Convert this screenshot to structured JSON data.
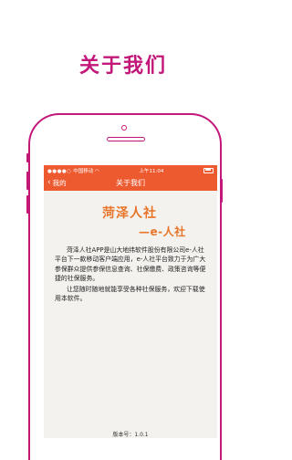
{
  "headline": "关于我们",
  "status_bar": {
    "carrier": "中国移动",
    "time": "上午11:04"
  },
  "nav": {
    "back_label": "我的",
    "title": "关于我们"
  },
  "logo": {
    "line1": "菏泽人社",
    "line2": "—e-人社"
  },
  "description": {
    "para1": "菏泽人社APP是山大地纬软件股份有限公司e-人社平台下一款移动客户端应用，e-人社平台致力于为广大参保群众提供参保信息查询、社保缴费、政策咨询等便捷的社保服务。",
    "para2": "让您随时随地就能享受各种社保服务，欢迎下载使用本软件。"
  },
  "version": "版本号：1.0.1",
  "colors": {
    "accent": "#c2187a",
    "bar": "#ee5a30",
    "logo": "#e8742a"
  }
}
